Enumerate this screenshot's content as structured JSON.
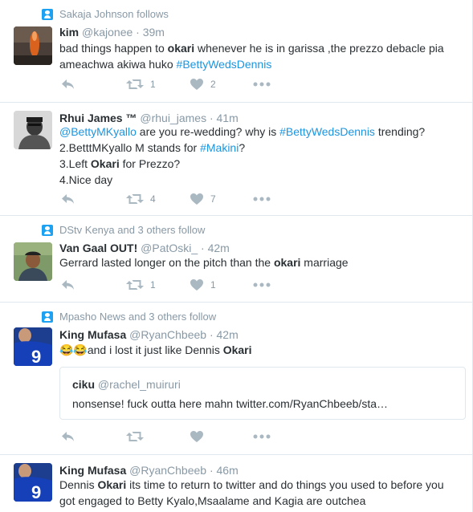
{
  "tweets": [
    {
      "social_context": "Sakaja Johnson follows",
      "fullname": "kim",
      "handle": "@kajonee",
      "time": "39m",
      "text_lines": [
        [
          {
            "t": "bad things happen to "
          },
          {
            "t": "okari",
            "s": "bold"
          },
          {
            "t": " whenever he is in garissa ,the prezzo debacle pia"
          }
        ],
        [
          {
            "t": "ameachwa akiwa huko "
          },
          {
            "t": "#BettyWedsDennis",
            "s": "tag"
          }
        ]
      ],
      "retweets": "1",
      "likes": "2"
    },
    {
      "social_context": "",
      "fullname": "Rhui James ™",
      "handle": "@rhui_james",
      "time": "41m",
      "text_lines": [
        [
          {
            "t": "@BettyMKyallo",
            "s": "tag"
          },
          {
            "t": " are you re-wedding? why is "
          },
          {
            "t": "#BettyWedsDennis",
            "s": "tag"
          },
          {
            "t": " trending?"
          }
        ],
        [
          {
            "t": "2.BetttMKyallo M stands for "
          },
          {
            "t": "#Makini",
            "s": "tag"
          },
          {
            "t": "?"
          }
        ],
        [
          {
            "t": "3.Left "
          },
          {
            "t": "Okari",
            "s": "bold"
          },
          {
            "t": " for Prezzo?"
          }
        ],
        [
          {
            "t": "4.Nice day"
          }
        ]
      ],
      "retweets": "4",
      "likes": "7"
    },
    {
      "social_context": "DStv Kenya and 3 others follow",
      "fullname": "Van Gaal OUT!",
      "handle": "@PatOski_",
      "time": "42m",
      "text_lines": [
        [
          {
            "t": "Gerrard lasted longer on the pitch than the "
          },
          {
            "t": "okari",
            "s": "bold"
          },
          {
            "t": " marriage"
          }
        ]
      ],
      "retweets": "1",
      "likes": "1"
    },
    {
      "social_context": "Mpasho News and 3 others follow",
      "fullname": "King Mufasa",
      "handle": "@RyanChbeeb",
      "time": "42m",
      "text_lines": [
        [
          {
            "t": "😂😂and i lost it just like Dennis "
          },
          {
            "t": "Okari",
            "s": "bold"
          }
        ]
      ],
      "quote": {
        "fullname": "ciku",
        "handle": "@rachel_muiruri",
        "text": "nonsense! fuck outta here mahn twitter.com/RyanChbeeb/sta…"
      },
      "retweets": "",
      "likes": ""
    },
    {
      "social_context": "",
      "fullname": "King Mufasa",
      "handle": "@RyanChbeeb",
      "time": "46m",
      "text_lines": [
        [
          {
            "t": "Dennis "
          },
          {
            "t": "Okari",
            "s": "bold"
          },
          {
            "t": " its time to return to twitter and do things you used to before you"
          }
        ],
        [
          {
            "t": "got engaged to Betty Kyalo,Msaalame and Kagia are outchea"
          }
        ]
      ],
      "retweets": "",
      "likes": ""
    }
  ],
  "colors": {
    "link": "#1b95e0",
    "meta": "#8899a6",
    "icon": "#aab8c2",
    "text": "#292f33",
    "border": "#e1e8ed"
  }
}
